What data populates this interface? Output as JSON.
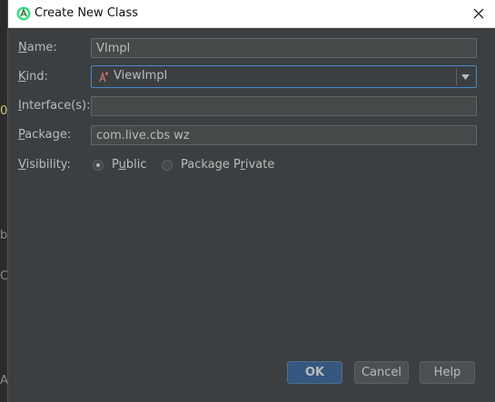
{
  "dialog": {
    "title": "Create New Class",
    "close_icon": "close-icon",
    "app_icon": "android-studio-icon"
  },
  "form": {
    "name": {
      "label_pre": "",
      "label_mn": "N",
      "label_post": "ame:",
      "value": "VImpl"
    },
    "kind": {
      "label_pre": "",
      "label_mn": "K",
      "label_post": "ind:",
      "value": "ViewImpl",
      "icon": "template-icon"
    },
    "interfaces": {
      "label_pre": "",
      "label_mn": "I",
      "label_post": "nterface(s):",
      "value": ""
    },
    "package": {
      "label_pre": "",
      "label_mn": "P",
      "label_post": "ackage:",
      "value": "com.live.cbs wz"
    },
    "visibility": {
      "label_pre": "",
      "label_mn": "V",
      "label_post": "isibility:",
      "options": [
        {
          "pre": "P",
          "mn": "u",
          "post": "blic",
          "selected": true
        },
        {
          "pre": "Package P",
          "mn": "r",
          "post": "ivate",
          "selected": false
        }
      ]
    }
  },
  "buttons": {
    "ok": "OK",
    "cancel": "Cancel",
    "help": "Help"
  },
  "background_glyphs": [
    "0",
    "b",
    "C",
    "A"
  ],
  "colors": {
    "dialog_bg": "#3c3f41",
    "focus_border": "#4a88c7",
    "default_button": "#365880"
  }
}
